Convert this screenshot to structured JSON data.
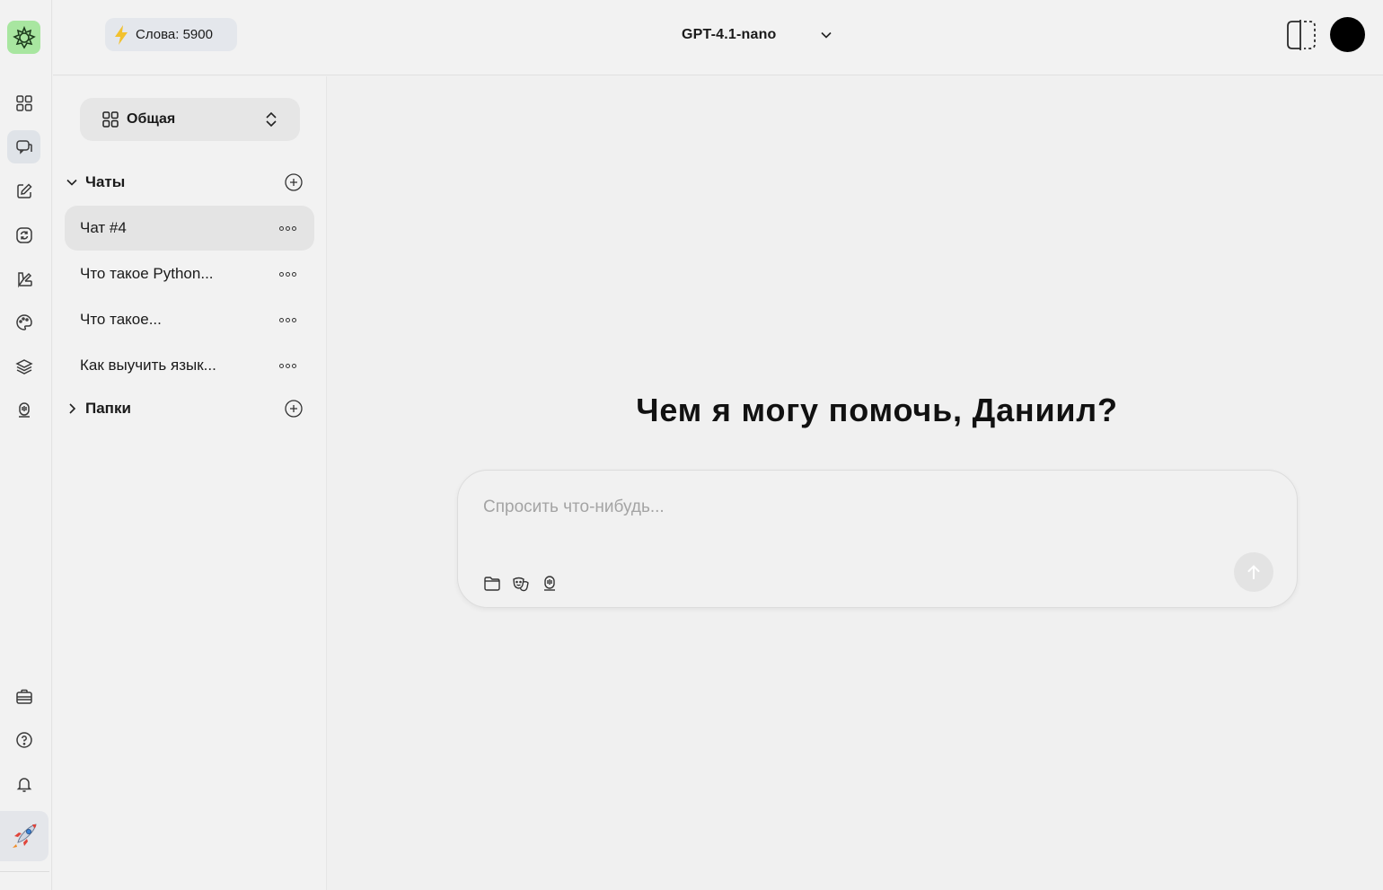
{
  "header": {
    "words_label": "Слова: 5900",
    "model_name": "GPT-4.1-nano"
  },
  "rail": {
    "items": [
      {
        "icon": "dashboard-icon"
      },
      {
        "icon": "chat-icon",
        "active": true
      },
      {
        "icon": "edit-icon"
      },
      {
        "icon": "refresh-icon"
      },
      {
        "icon": "brush-icon"
      },
      {
        "icon": "palette-icon"
      },
      {
        "icon": "layers-icon"
      },
      {
        "icon": "microphone-icon"
      }
    ],
    "bottom_items": [
      {
        "icon": "briefcase-icon"
      },
      {
        "icon": "help-icon"
      },
      {
        "icon": "bell-icon"
      },
      {
        "icon": "rocket-icon"
      }
    ]
  },
  "sidebar": {
    "workspace": "Общая",
    "chats_title": "Чаты",
    "chats": [
      {
        "label": "Чат #4",
        "active": true
      },
      {
        "label": "Что такое Python..."
      },
      {
        "label": "Что такое..."
      },
      {
        "label": "Как выучить язык..."
      }
    ],
    "folders_title": "Папки"
  },
  "main": {
    "greeting": "Чем я могу помочь, Даниил?",
    "input_placeholder": "Спросить что-нибудь...",
    "input_value": ""
  },
  "colors": {
    "logo_bg": "#a8e6a0",
    "accent_bolt": "#f2c12e",
    "avatar": "#000000"
  }
}
